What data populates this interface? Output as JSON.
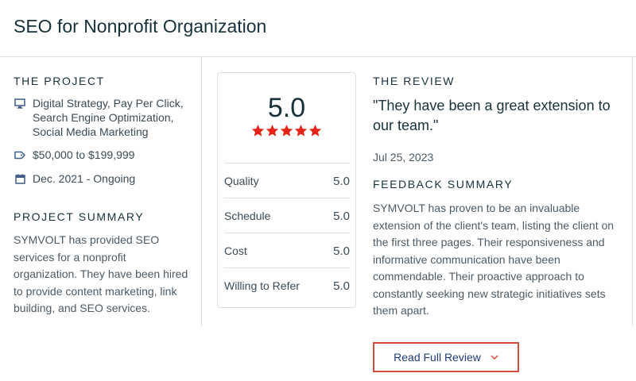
{
  "header": {
    "title": "SEO for Nonprofit Organization"
  },
  "project": {
    "heading": "THE PROJECT",
    "services": "Digital Strategy, Pay Per Click, Search Engine Optimization, Social Media Marketing",
    "services_icon": "monitor-icon",
    "budget": "$50,000 to $199,999",
    "budget_icon": "price-tag-icon",
    "timeline": "Dec. 2021 - Ongoing",
    "timeline_icon": "calendar-icon"
  },
  "project_summary": {
    "heading": "PROJECT SUMMARY",
    "text": "SYMVOLT has provided SEO services for a nonprofit organization. They have been hired to provide content marketing, link building, and SEO services."
  },
  "ratings": {
    "overall": "5.0",
    "stars": 5,
    "star_color": "#e62415",
    "rows": [
      {
        "label": "Quality",
        "value": "5.0"
      },
      {
        "label": "Schedule",
        "value": "5.0"
      },
      {
        "label": "Cost",
        "value": "5.0"
      },
      {
        "label": "Willing to Refer",
        "value": "5.0"
      }
    ]
  },
  "review": {
    "heading": "THE REVIEW",
    "quote": "\"They have been a great extension to our team.\"",
    "date": "Jul 25, 2023",
    "feedback_heading": "FEEDBACK SUMMARY",
    "feedback_text": "SYMVOLT has proven to be an invaluable extension of the client's team, listing the client on the first three pages. Their responsiveness and informative communication have been commendable. Their proactive approach to constantly seeking new strategic initiatives sets them apart.",
    "button_label": "Read Full Review",
    "button_icon": "chevron-down-icon",
    "accent_color": "#d34a3f"
  }
}
